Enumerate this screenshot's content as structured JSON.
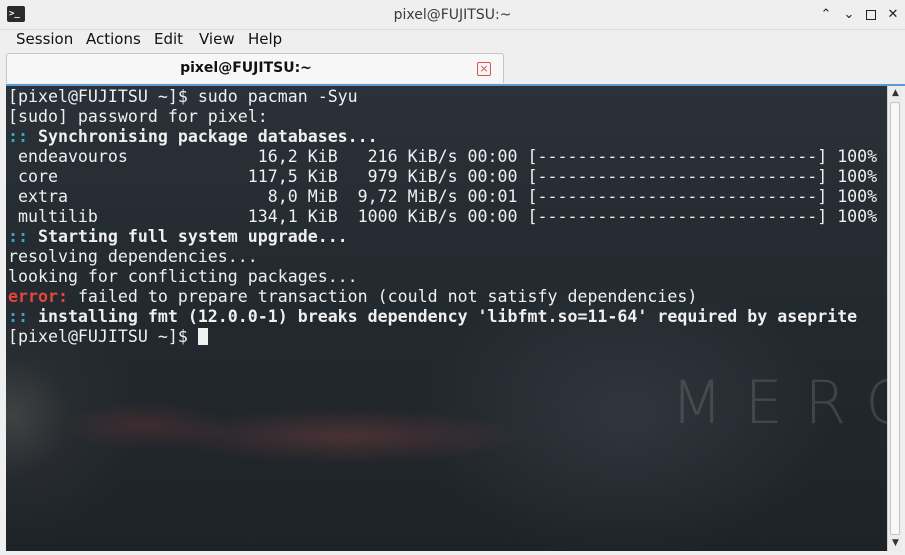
{
  "window": {
    "title": "pixel@FUJITSU:~",
    "app_icon_glyph": ">_",
    "controls": {
      "up": "⌃",
      "down": "⌄",
      "close": "✕"
    }
  },
  "menu": {
    "items": [
      "Session",
      "Actions",
      "Edit",
      "View",
      "Help"
    ]
  },
  "tab": {
    "label": "pixel@FUJITSU:~",
    "close_glyph": "×"
  },
  "terminal": {
    "watermark": "MERCU",
    "lines": [
      {
        "segments": [
          {
            "text": "[pixel@FUJITSU ~]$ sudo pacman -Syu",
            "style": "normal"
          }
        ]
      },
      {
        "segments": [
          {
            "text": "[sudo] password for pixel:",
            "style": "normal"
          }
        ]
      },
      {
        "segments": [
          {
            "text": "::",
            "style": "cyan"
          },
          {
            "text": " Synchronising package databases...",
            "style": "bold"
          }
        ]
      },
      {
        "segments": [
          {
            "text": " endeavouros             16,2 KiB   216 KiB/s 00:00 [----------------------------] 100%",
            "style": "normal"
          }
        ]
      },
      {
        "segments": [
          {
            "text": " core                   117,5 KiB   979 KiB/s 00:00 [----------------------------] 100%",
            "style": "normal"
          }
        ]
      },
      {
        "segments": [
          {
            "text": " extra                    8,0 MiB  9,72 MiB/s 00:01 [----------------------------] 100%",
            "style": "normal"
          }
        ]
      },
      {
        "segments": [
          {
            "text": " multilib               134,1 KiB  1000 KiB/s 00:00 [----------------------------] 100%",
            "style": "normal"
          }
        ]
      },
      {
        "segments": [
          {
            "text": "::",
            "style": "cyan"
          },
          {
            "text": " Starting full system upgrade...",
            "style": "bold"
          }
        ]
      },
      {
        "segments": [
          {
            "text": "resolving dependencies...",
            "style": "normal"
          }
        ]
      },
      {
        "segments": [
          {
            "text": "looking for conflicting packages...",
            "style": "normal"
          }
        ]
      },
      {
        "segments": [
          {
            "text": "error:",
            "style": "red"
          },
          {
            "text": " failed to prepare transaction (could not satisfy dependencies)",
            "style": "normal"
          }
        ]
      },
      {
        "segments": [
          {
            "text": "::",
            "style": "cyan"
          },
          {
            "text": " installing fmt (12.0.0-1) breaks dependency 'libfmt.so=11-64' required by aseprite",
            "style": "bold"
          }
        ]
      },
      {
        "segments": [
          {
            "text": "[pixel@FUJITSU ~]$ ",
            "style": "normal"
          }
        ],
        "cursor": true
      }
    ]
  },
  "colors": {
    "accent": "#5b9bd5",
    "prompt_cyan": "#3aa6c6",
    "error_red": "#e8443c"
  }
}
